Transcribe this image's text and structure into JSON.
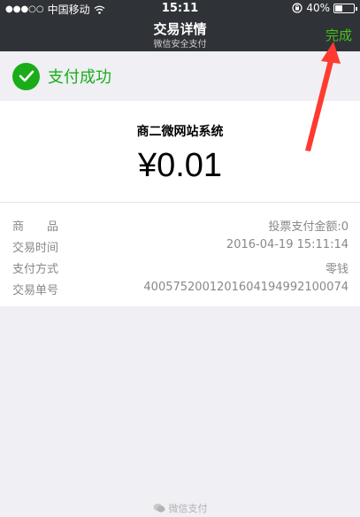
{
  "status_bar": {
    "carrier": "中国移动",
    "time": "15:11",
    "battery": "40%",
    "battery_level": 0.4
  },
  "nav": {
    "title": "交易详情",
    "subtitle": "微信安全支付",
    "done_label": "完成"
  },
  "result": {
    "message": "支付成功",
    "color": "#1aad19"
  },
  "payment": {
    "merchant": "商二微网站系统",
    "amount": "¥0.01"
  },
  "details": [
    {
      "label": "商　　品",
      "value": "投票支付金额:0"
    },
    {
      "label": "交易时间",
      "value": "2016-04-19 15:11:14"
    },
    {
      "label": "支付方式",
      "value": "零钱"
    },
    {
      "label": "交易单号",
      "value": "4005752001201604194992100074"
    }
  ],
  "footer": {
    "text": "微信支付"
  },
  "colors": {
    "accent": "#45c01a",
    "annotation": "#ff3b30"
  },
  "icons": [
    "signal-dots-icon",
    "wifi-icon",
    "lock-rotation-icon",
    "battery-icon",
    "check-circle-icon",
    "annotation-arrow",
    "wechat-pay-icon"
  ]
}
